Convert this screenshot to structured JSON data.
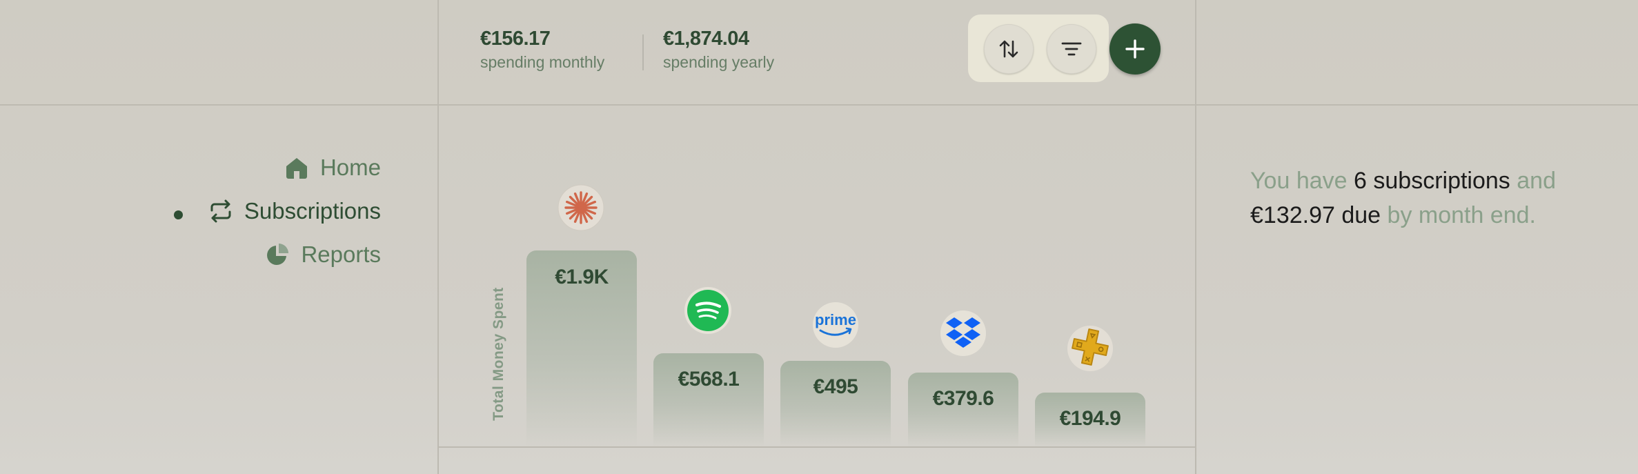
{
  "header": {
    "monthly": {
      "value": "€156.17",
      "label": "spending monthly"
    },
    "yearly": {
      "value": "€1,874.04",
      "label": "spending yearly"
    }
  },
  "toolbar": {
    "sort_icon": "sort-arrows-icon",
    "filter_icon": "filter-lines-icon",
    "add_icon": "plus-icon"
  },
  "nav": {
    "items": [
      {
        "label": "Home",
        "icon": "home-icon"
      },
      {
        "label": "Subscriptions",
        "icon": "repeat-icon",
        "active": true
      },
      {
        "label": "Reports",
        "icon": "pie-chart-icon"
      }
    ]
  },
  "chart_data": {
    "type": "bar",
    "ylabel": "Total Money Spent",
    "categories": [
      "claude-icon",
      "spotify-icon",
      "prime-icon",
      "dropbox-icon",
      "playstation-plus-icon"
    ],
    "values": [
      1900,
      568.1,
      495,
      379.6,
      194.9
    ],
    "value_labels": [
      "€1.9K",
      "€568.1",
      "€495",
      "€379.6",
      "€194.9"
    ],
    "prime_logo_text": "prime"
  },
  "summary": {
    "p1": "You have",
    "count": "6 subscriptions",
    "p2": "and",
    "amount": "€132.97 due",
    "p3": "by month end."
  },
  "colors": {
    "accent": "#2d5234",
    "background": "#cfccc3",
    "muted_green": "#8aa08a"
  }
}
